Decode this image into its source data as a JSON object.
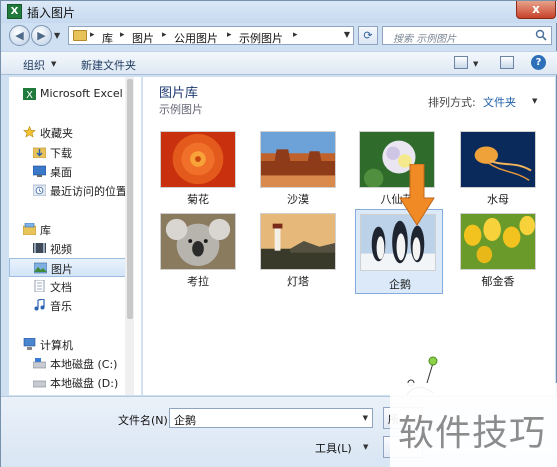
{
  "window": {
    "title": "插入图片",
    "icon": "excel-icon",
    "close_label": "x"
  },
  "address_bar": {
    "crumbs": [
      "库",
      "图片",
      "公用图片",
      "示例图片"
    ],
    "search_placeholder": "搜索 示例图片"
  },
  "toolbar": {
    "organize_label": "组织",
    "new_folder_label": "新建文件夹"
  },
  "nav": {
    "items": [
      {
        "label": "Microsoft Excel",
        "icon": "excel-icon"
      },
      {
        "label": "收藏夹",
        "icon": "star-icon"
      },
      {
        "label": "下载",
        "icon": "download-folder-icon"
      },
      {
        "label": "桌面",
        "icon": "desktop-icon"
      },
      {
        "label": "最近访问的位置",
        "icon": "recent-places-icon"
      },
      {
        "label": "库",
        "icon": "library-icon"
      },
      {
        "label": "视频",
        "icon": "video-icon"
      },
      {
        "label": "图片",
        "icon": "picture-icon"
      },
      {
        "label": "文档",
        "icon": "document-icon"
      },
      {
        "label": "音乐",
        "icon": "music-icon"
      },
      {
        "label": "计算机",
        "icon": "computer-icon"
      },
      {
        "label": "本地磁盘 (C:)",
        "icon": "drive-icon"
      },
      {
        "label": "本地磁盘 (D:)",
        "icon": "drive-icon"
      }
    ],
    "selected": "图片"
  },
  "library": {
    "title": "图片库",
    "subtitle": "示例图片",
    "arrange_label": "排列方式:",
    "arrange_value": "文件夹"
  },
  "thumbnails": [
    {
      "caption": "菊花"
    },
    {
      "caption": "沙漠"
    },
    {
      "caption": "八仙花"
    },
    {
      "caption": "水母"
    },
    {
      "caption": "考拉"
    },
    {
      "caption": "灯塔"
    },
    {
      "caption": "企鹅"
    },
    {
      "caption": "郁金香"
    }
  ],
  "bottom": {
    "filename_label": "文件名(N):",
    "filename_value": "企鹅",
    "file_type_label": "所",
    "tools_label": "工具(L)"
  },
  "watermark": {
    "text": "软件技巧"
  },
  "colors": {
    "accent": "#1f5fa8",
    "title_blue": "#1f3b70",
    "arrow": "#f08a24"
  }
}
